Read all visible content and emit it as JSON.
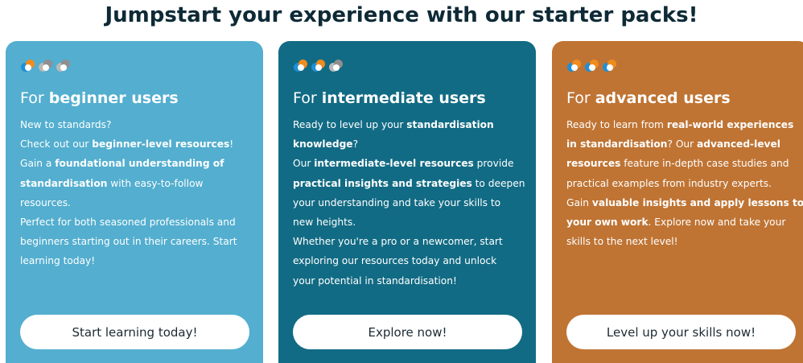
{
  "heading": "Jumpstart your experience with our starter packs!",
  "colors": {
    "heading": "#0e2a36",
    "icon_active_blue": "#1e8fd6",
    "icon_active_orange": "#f08c1e",
    "icon_inactive": "#b9b9b9"
  },
  "cards": [
    {
      "bg": "#53aecf",
      "icons": [
        {
          "name": "pack-icon",
          "active": true
        },
        {
          "name": "pack-icon",
          "active": false
        },
        {
          "name": "pack-icon",
          "active": false
        }
      ],
      "title_prefix": "For ",
      "title_bold": "beginner users",
      "lines": [
        [
          {
            "t": "New to standards?",
            "b": false
          }
        ],
        [
          {
            "t": "Check out our ",
            "b": false
          },
          {
            "t": "beginner-level resources",
            "b": true
          },
          {
            "t": "!",
            "b": false
          }
        ],
        [
          {
            "t": "Gain a ",
            "b": false
          },
          {
            "t": "foundational understanding of",
            "b": true
          }
        ],
        [
          {
            "t": "standardisation",
            "b": true
          },
          {
            "t": " with easy-to-follow",
            "b": false
          }
        ],
        [
          {
            "t": "resources.",
            "b": false
          }
        ],
        [
          {
            "t": "Perfect for both seasoned professionals and",
            "b": false
          }
        ],
        [
          {
            "t": "beginners starting out in their careers. Start",
            "b": false
          }
        ],
        [
          {
            "t": "learning today!",
            "b": false
          }
        ]
      ],
      "button": "Start learning today!"
    },
    {
      "bg": "#126b84",
      "icons": [
        {
          "name": "pack-icon",
          "active": true
        },
        {
          "name": "pack-icon",
          "active": true
        },
        {
          "name": "pack-icon",
          "active": false
        }
      ],
      "title_prefix": "For ",
      "title_bold": "intermediate users",
      "lines": [
        [
          {
            "t": "Ready to level up your ",
            "b": false
          },
          {
            "t": "standardisation",
            "b": true
          }
        ],
        [
          {
            "t": "knowledge",
            "b": true
          },
          {
            "t": "?",
            "b": false
          }
        ],
        [
          {
            "t": "Our ",
            "b": false
          },
          {
            "t": "intermediate-level resources",
            "b": true
          },
          {
            "t": " provide",
            "b": false
          }
        ],
        [
          {
            "t": "practical insights and strategies",
            "b": true
          },
          {
            "t": " to deepen",
            "b": false
          }
        ],
        [
          {
            "t": "your understanding and take your skills to",
            "b": false
          }
        ],
        [
          {
            "t": "new heights.",
            "b": false
          }
        ],
        [
          {
            "t": "Whether you're a pro or a newcomer, start",
            "b": false
          }
        ],
        [
          {
            "t": "exploring our resources today and unlock",
            "b": false
          }
        ],
        [
          {
            "t": "your potential in standardisation!",
            "b": false
          }
        ]
      ],
      "button": "Explore now!"
    },
    {
      "bg": "#bf7434",
      "icons": [
        {
          "name": "pack-icon",
          "active": true
        },
        {
          "name": "pack-icon",
          "active": true
        },
        {
          "name": "pack-icon",
          "active": true
        }
      ],
      "title_prefix": "For ",
      "title_bold": "advanced users",
      "lines": [
        [
          {
            "t": "Ready to learn from ",
            "b": false
          },
          {
            "t": "real-world experiences",
            "b": true
          }
        ],
        [
          {
            "t": "in standardisation",
            "b": true
          },
          {
            "t": "? Our ",
            "b": false
          },
          {
            "t": "advanced-level",
            "b": true
          }
        ],
        [
          {
            "t": "resources",
            "b": true
          },
          {
            "t": " feature in-depth case studies and",
            "b": false
          }
        ],
        [
          {
            "t": "practical examples from industry experts.",
            "b": false
          }
        ],
        [
          {
            "t": "Gain ",
            "b": false
          },
          {
            "t": "valuable insights and apply lessons to",
            "b": true
          }
        ],
        [
          {
            "t": "your own work",
            "b": true
          },
          {
            "t": ". Explore now and take your",
            "b": false
          }
        ],
        [
          {
            "t": "skills to the next level!",
            "b": false
          }
        ]
      ],
      "button": "Level up your skills now!"
    }
  ]
}
